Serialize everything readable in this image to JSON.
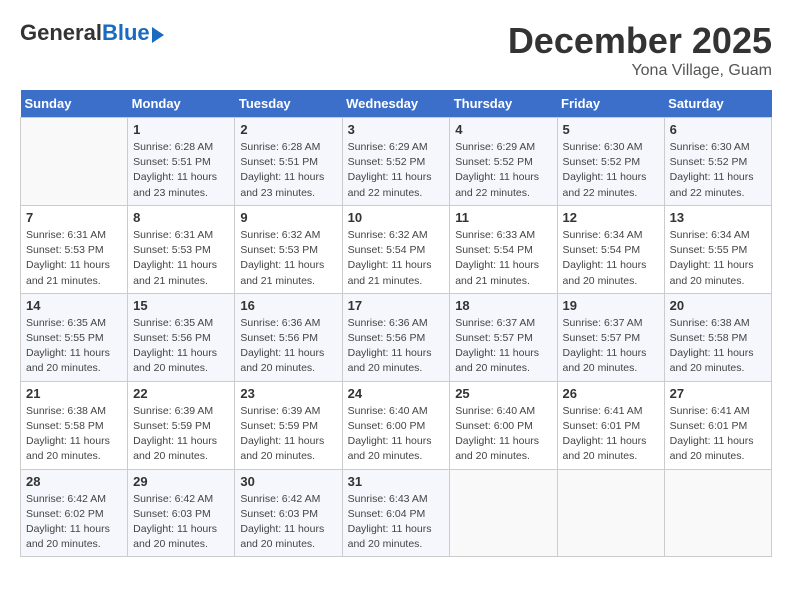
{
  "header": {
    "logo_general": "General",
    "logo_blue": "Blue",
    "month": "December 2025",
    "location": "Yona Village, Guam"
  },
  "days_of_week": [
    "Sunday",
    "Monday",
    "Tuesday",
    "Wednesday",
    "Thursday",
    "Friday",
    "Saturday"
  ],
  "weeks": [
    [
      {
        "day": "",
        "sunrise": "",
        "sunset": "",
        "daylight": ""
      },
      {
        "day": "1",
        "sunrise": "6:28 AM",
        "sunset": "5:51 PM",
        "daylight": "11 hours and 23 minutes."
      },
      {
        "day": "2",
        "sunrise": "6:28 AM",
        "sunset": "5:51 PM",
        "daylight": "11 hours and 23 minutes."
      },
      {
        "day": "3",
        "sunrise": "6:29 AM",
        "sunset": "5:52 PM",
        "daylight": "11 hours and 22 minutes."
      },
      {
        "day": "4",
        "sunrise": "6:29 AM",
        "sunset": "5:52 PM",
        "daylight": "11 hours and 22 minutes."
      },
      {
        "day": "5",
        "sunrise": "6:30 AM",
        "sunset": "5:52 PM",
        "daylight": "11 hours and 22 minutes."
      },
      {
        "day": "6",
        "sunrise": "6:30 AM",
        "sunset": "5:52 PM",
        "daylight": "11 hours and 22 minutes."
      }
    ],
    [
      {
        "day": "7",
        "sunrise": "6:31 AM",
        "sunset": "5:53 PM",
        "daylight": "11 hours and 21 minutes."
      },
      {
        "day": "8",
        "sunrise": "6:31 AM",
        "sunset": "5:53 PM",
        "daylight": "11 hours and 21 minutes."
      },
      {
        "day": "9",
        "sunrise": "6:32 AM",
        "sunset": "5:53 PM",
        "daylight": "11 hours and 21 minutes."
      },
      {
        "day": "10",
        "sunrise": "6:32 AM",
        "sunset": "5:54 PM",
        "daylight": "11 hours and 21 minutes."
      },
      {
        "day": "11",
        "sunrise": "6:33 AM",
        "sunset": "5:54 PM",
        "daylight": "11 hours and 21 minutes."
      },
      {
        "day": "12",
        "sunrise": "6:34 AM",
        "sunset": "5:54 PM",
        "daylight": "11 hours and 20 minutes."
      },
      {
        "day": "13",
        "sunrise": "6:34 AM",
        "sunset": "5:55 PM",
        "daylight": "11 hours and 20 minutes."
      }
    ],
    [
      {
        "day": "14",
        "sunrise": "6:35 AM",
        "sunset": "5:55 PM",
        "daylight": "11 hours and 20 minutes."
      },
      {
        "day": "15",
        "sunrise": "6:35 AM",
        "sunset": "5:56 PM",
        "daylight": "11 hours and 20 minutes."
      },
      {
        "day": "16",
        "sunrise": "6:36 AM",
        "sunset": "5:56 PM",
        "daylight": "11 hours and 20 minutes."
      },
      {
        "day": "17",
        "sunrise": "6:36 AM",
        "sunset": "5:56 PM",
        "daylight": "11 hours and 20 minutes."
      },
      {
        "day": "18",
        "sunrise": "6:37 AM",
        "sunset": "5:57 PM",
        "daylight": "11 hours and 20 minutes."
      },
      {
        "day": "19",
        "sunrise": "6:37 AM",
        "sunset": "5:57 PM",
        "daylight": "11 hours and 20 minutes."
      },
      {
        "day": "20",
        "sunrise": "6:38 AM",
        "sunset": "5:58 PM",
        "daylight": "11 hours and 20 minutes."
      }
    ],
    [
      {
        "day": "21",
        "sunrise": "6:38 AM",
        "sunset": "5:58 PM",
        "daylight": "11 hours and 20 minutes."
      },
      {
        "day": "22",
        "sunrise": "6:39 AM",
        "sunset": "5:59 PM",
        "daylight": "11 hours and 20 minutes."
      },
      {
        "day": "23",
        "sunrise": "6:39 AM",
        "sunset": "5:59 PM",
        "daylight": "11 hours and 20 minutes."
      },
      {
        "day": "24",
        "sunrise": "6:40 AM",
        "sunset": "6:00 PM",
        "daylight": "11 hours and 20 minutes."
      },
      {
        "day": "25",
        "sunrise": "6:40 AM",
        "sunset": "6:00 PM",
        "daylight": "11 hours and 20 minutes."
      },
      {
        "day": "26",
        "sunrise": "6:41 AM",
        "sunset": "6:01 PM",
        "daylight": "11 hours and 20 minutes."
      },
      {
        "day": "27",
        "sunrise": "6:41 AM",
        "sunset": "6:01 PM",
        "daylight": "11 hours and 20 minutes."
      }
    ],
    [
      {
        "day": "28",
        "sunrise": "6:42 AM",
        "sunset": "6:02 PM",
        "daylight": "11 hours and 20 minutes."
      },
      {
        "day": "29",
        "sunrise": "6:42 AM",
        "sunset": "6:03 PM",
        "daylight": "11 hours and 20 minutes."
      },
      {
        "day": "30",
        "sunrise": "6:42 AM",
        "sunset": "6:03 PM",
        "daylight": "11 hours and 20 minutes."
      },
      {
        "day": "31",
        "sunrise": "6:43 AM",
        "sunset": "6:04 PM",
        "daylight": "11 hours and 20 minutes."
      },
      {
        "day": "",
        "sunrise": "",
        "sunset": "",
        "daylight": ""
      },
      {
        "day": "",
        "sunrise": "",
        "sunset": "",
        "daylight": ""
      },
      {
        "day": "",
        "sunrise": "",
        "sunset": "",
        "daylight": ""
      }
    ]
  ],
  "labels": {
    "sunrise": "Sunrise:",
    "sunset": "Sunset:",
    "daylight": "Daylight:"
  }
}
